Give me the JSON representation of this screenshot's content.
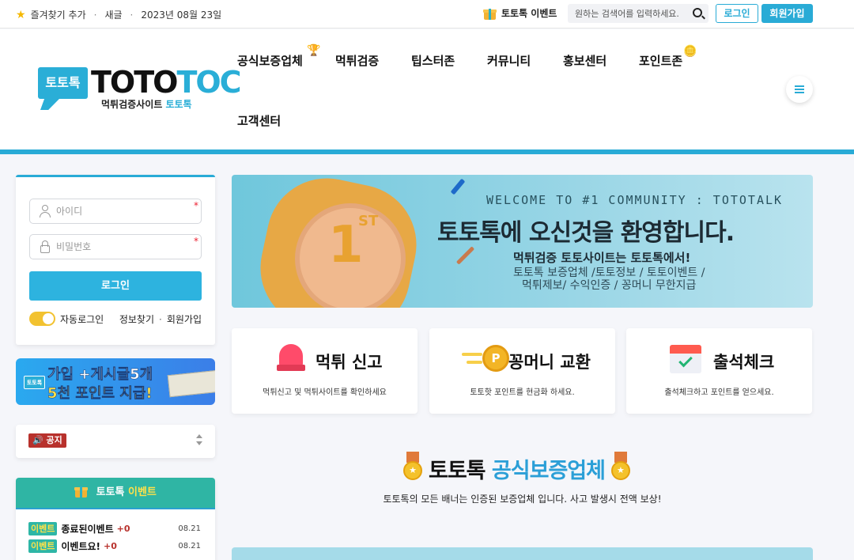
{
  "topbar": {
    "bookmark": "즐겨찾기 추가",
    "dot1": "·",
    "new_post": "새글",
    "dot2": "·",
    "date": "2023년 08월 23일",
    "event_label": "토토톡 이벤트",
    "search_placeholder": "원하는 검색어를 입력하세요.",
    "login_label": "로그인",
    "join_label": "회원가입"
  },
  "logo": {
    "bubble_text": "토토톡",
    "name_a": "TOTO",
    "name_b": "TOC",
    "sub_a": "먹튀검증사이트 ",
    "sub_b": "토토톡"
  },
  "nav": {
    "items": [
      "공식보증업체",
      "먹튀검증",
      "팁스터존",
      "커뮤니티",
      "홍보센터",
      "포인트존",
      "고객센터"
    ]
  },
  "login": {
    "id_placeholder": "아이디",
    "pw_placeholder": "비밀번호",
    "required_mark": "*",
    "button_label": "로그인",
    "auto_login": "자동로그인",
    "find_info": "정보찾기",
    "dot": "·",
    "join": "회원가입"
  },
  "promo": {
    "mini": "토토톡",
    "line1": "가입 +게시글5개",
    "line2": "5천 포인트 지급!"
  },
  "notice": {
    "tag": "🔊 공지"
  },
  "event_box": {
    "title_a": "토토톡 ",
    "title_b": "이벤트",
    "rows": [
      {
        "badge": "이벤트",
        "title": "종료된이벤트",
        "count": "+0",
        "date": "08.21"
      },
      {
        "badge": "이벤트",
        "title": "이벤트요!",
        "count": "+0",
        "date": "08.21"
      }
    ]
  },
  "hero": {
    "welcome": "WELCOME TO #1 COMMUNITY : TOTOTALK",
    "headline": "토토톡에 오신것을 환영합니다.",
    "sub1": "먹튀검증 토토사이트는 토토톡에서!",
    "sub2": "토토톡 보증업체 /토토정보 / 토토이벤트 /",
    "sub3": "먹튀제보/ 수익인증 / 꽁머니 무한지급",
    "badge_num": "1",
    "badge_suffix": "ST"
  },
  "cards": [
    {
      "title": "먹튀 신고",
      "desc": "먹튀신고 및 먹튀사이트를 확인하세요",
      "icon": "siren-icon"
    },
    {
      "title": "꽁머니 교환",
      "desc": "토토핫 포인트를 현금화 하세요.",
      "icon": "coin-icon"
    },
    {
      "title": "출석체크",
      "desc": "출석체크하고 포인트를 얻으세요.",
      "icon": "calendar-check-icon"
    }
  ],
  "section": {
    "title_a": "토토톡 ",
    "title_b": "공식보증업체",
    "subtitle": "토토톡의 모든 배너는 인증된 보증업체 입니다. 사고 발생시 전액 보상!"
  },
  "colors": {
    "accent": "#29abd6",
    "toggle": "#f2c230",
    "event_head": "#2fb5a4",
    "notice_tag": "#b8312c"
  }
}
